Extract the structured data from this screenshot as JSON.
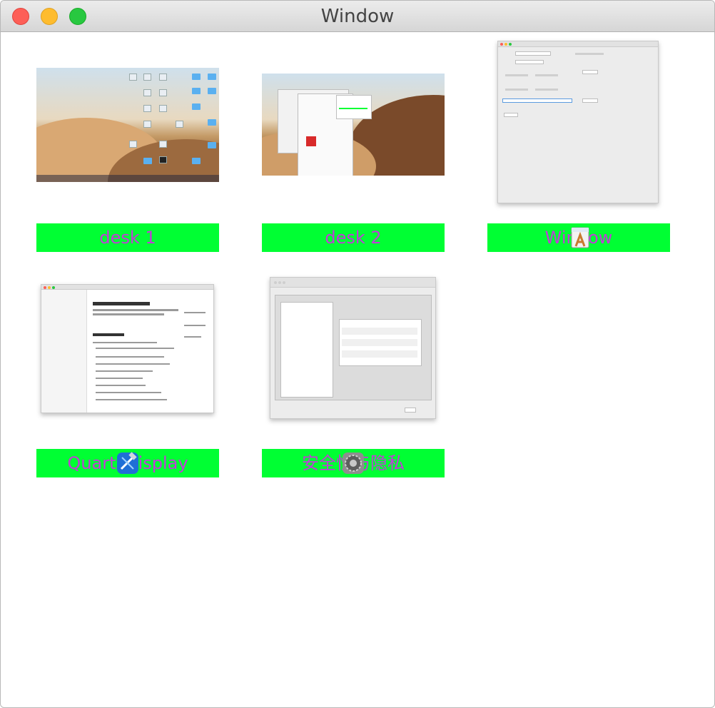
{
  "window": {
    "title": "Window"
  },
  "items": [
    {
      "label": "desk 1",
      "icon": ""
    },
    {
      "label": "desk 2",
      "icon": ""
    },
    {
      "label": "Window",
      "icon": "textedit-app-icon"
    },
    {
      "label": "QuartzDisplay",
      "icon": "xcode-app-icon"
    },
    {
      "label": "安全性与隐私",
      "icon": "system-preferences-app-icon"
    }
  ],
  "colors": {
    "label_bg": "#00ff33",
    "label_text": "#c33bd9"
  }
}
